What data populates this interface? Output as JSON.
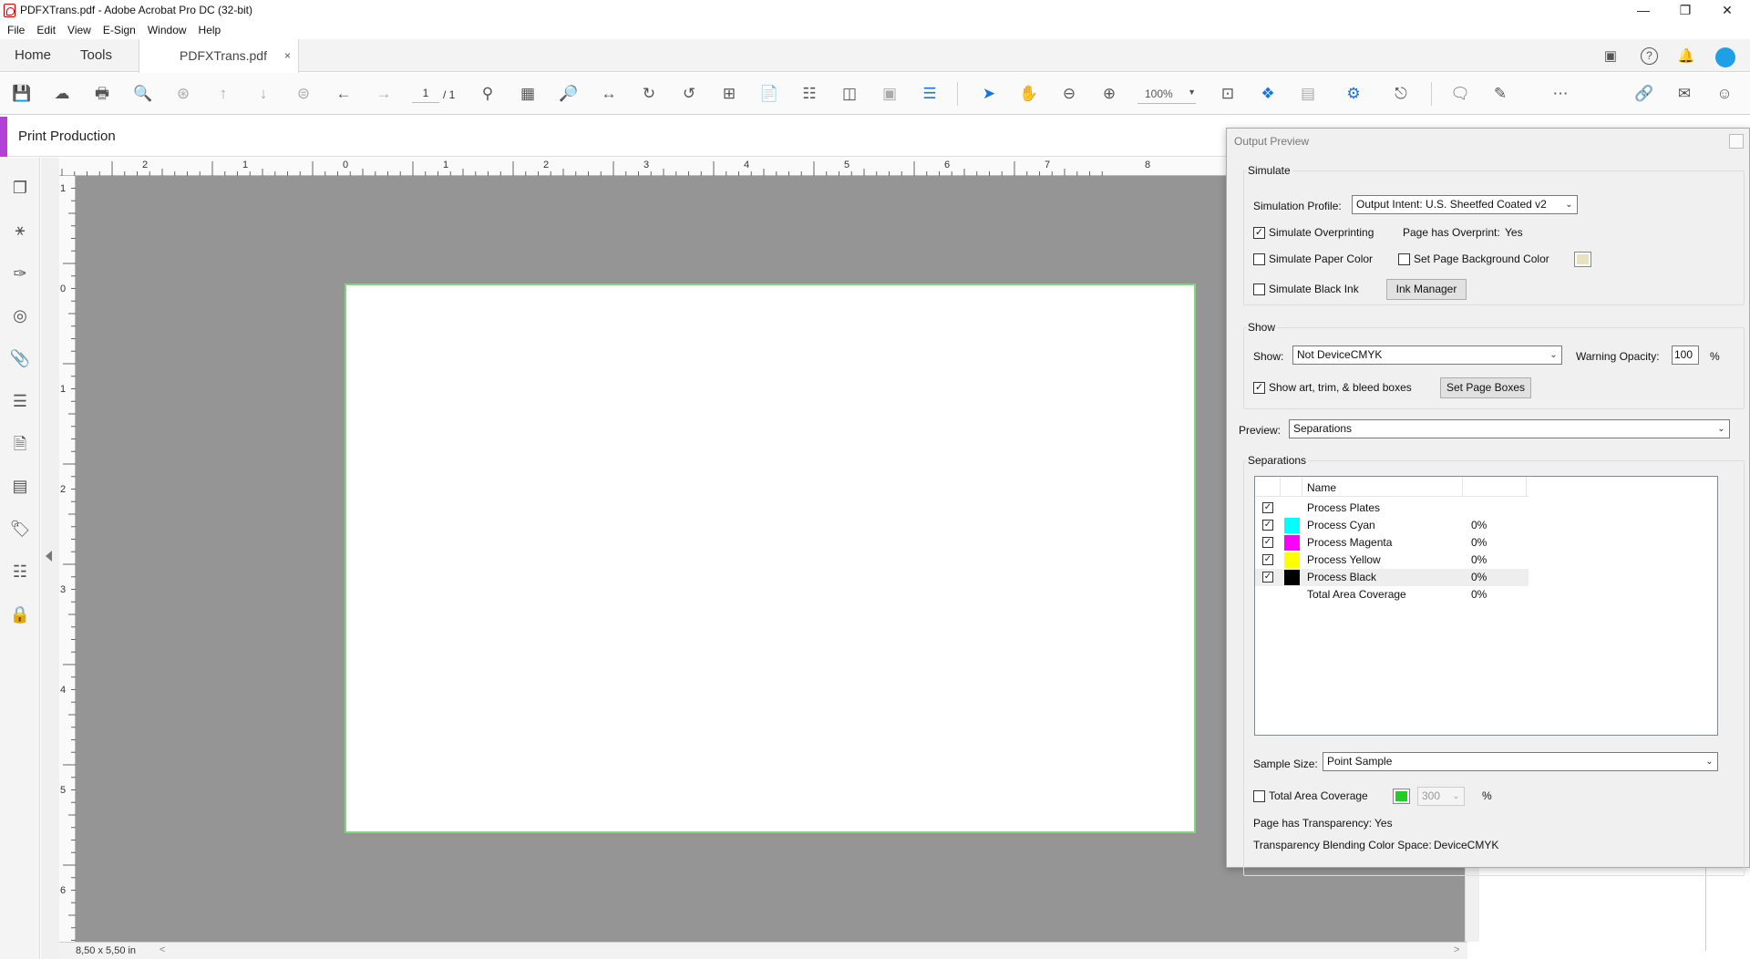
{
  "window": {
    "title": "PDFXTrans.pdf - Adobe Acrobat Pro DC (32-bit)"
  },
  "menu": [
    "File",
    "Edit",
    "View",
    "E-Sign",
    "Window",
    "Help"
  ],
  "tabs": {
    "home": "Home",
    "tools": "Tools",
    "document": "PDFXTrans.pdf",
    "close": "×"
  },
  "toolbar": {
    "page_current": "1",
    "page_total": "/ 1",
    "zoom": "100%"
  },
  "panel_header": "Print Production",
  "ruler": {
    "horizontal_ticks": [
      "2",
      "1",
      "0",
      "1",
      "2",
      "3",
      "4",
      "5",
      "6",
      "7",
      "8"
    ],
    "vertical_ticks": [
      "1",
      "0",
      "1",
      "2",
      "3",
      "4",
      "5",
      "6"
    ]
  },
  "status": {
    "page_size": "8,50 x 5,50 in",
    "scroll_left": "<",
    "scroll_right": ">"
  },
  "output_preview": {
    "title": "Output Preview",
    "simulate": {
      "group_label": "Simulate",
      "profile_label": "Simulation Profile:",
      "profile_value": "Output Intent: U.S. Sheetfed Coated v2",
      "simulate_overprinting": "Simulate Overprinting",
      "page_has_overprint_label": "Page has Overprint:",
      "page_has_overprint_value": "Yes",
      "simulate_paper_color": "Simulate Paper Color",
      "set_page_background_color": "Set Page Background Color",
      "simulate_black_ink": "Simulate Black Ink",
      "ink_manager": "Ink Manager",
      "page_background_swatch": "#e8e2c0"
    },
    "show": {
      "group_label": "Show",
      "show_label": "Show:",
      "show_value": "Not DeviceCMYK",
      "warning_opacity_label": "Warning Opacity:",
      "warning_opacity_value": "100",
      "percent": "%",
      "show_boxes": "Show art, trim, & bleed boxes",
      "set_page_boxes": "Set Page Boxes"
    },
    "preview": {
      "label": "Preview:",
      "value": "Separations"
    },
    "separations": {
      "group_label": "Separations",
      "column_name": "Name",
      "rows": [
        {
          "name": "Process Plates",
          "percent": "",
          "color": "",
          "checked": true
        },
        {
          "name": "Process Cyan",
          "percent": "0%",
          "color": "#00ffff",
          "checked": true
        },
        {
          "name": "Process Magenta",
          "percent": "0%",
          "color": "#ff00ff",
          "checked": true
        },
        {
          "name": "Process Yellow",
          "percent": "0%",
          "color": "#ffff00",
          "checked": true
        },
        {
          "name": "Process Black",
          "percent": "0%",
          "color": "#000000",
          "checked": true
        },
        {
          "name": "Total Area Coverage",
          "percent": "0%",
          "color": "",
          "checked": false
        }
      ]
    },
    "sample_size": {
      "label": "Sample Size:",
      "value": "Point Sample"
    },
    "total_area_coverage": {
      "label": "Total Area Coverage",
      "value": "300",
      "percent": "%",
      "swatch": "#22cc22"
    },
    "page_has_transparency": {
      "label": "Page has Transparency:",
      "value": "Yes"
    },
    "blending_space": {
      "label": "Transparency Blending Color Space:",
      "value": "DeviceCMYK"
    }
  },
  "colors": {
    "accent": "#b341d6",
    "blue": "#1473e6",
    "canvas": "#959595",
    "page_border": "#7ed67e"
  }
}
